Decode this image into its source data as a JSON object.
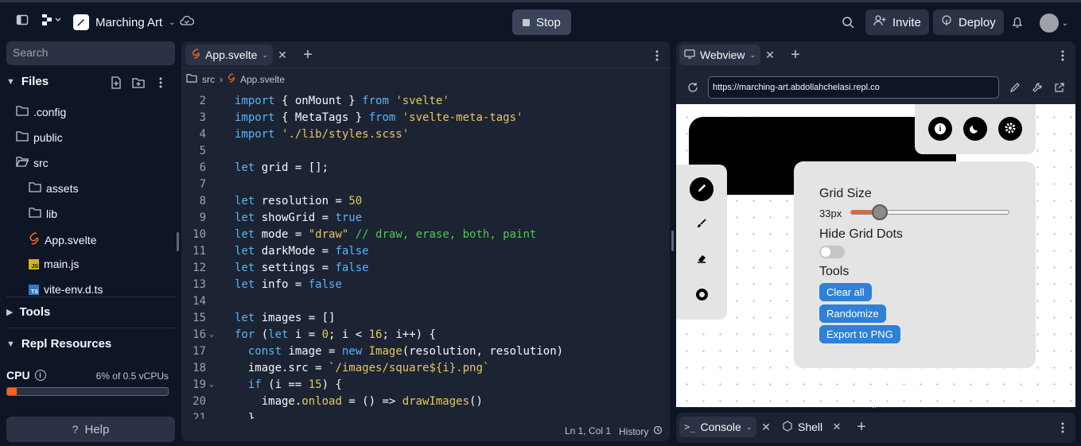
{
  "header": {
    "repl_name": "Marching Art",
    "stop_label": "Stop",
    "invite_label": "Invite",
    "deploy_label": "Deploy"
  },
  "sidebar": {
    "search_placeholder": "Search",
    "files_title": "Files",
    "items": [
      {
        "label": ".config",
        "icon": "folder-icon"
      },
      {
        "label": "public",
        "icon": "folder-icon"
      },
      {
        "label": "src",
        "icon": "folder-open-icon"
      },
      {
        "label": "assets",
        "icon": "folder-icon"
      },
      {
        "label": "lib",
        "icon": "folder-icon"
      },
      {
        "label": "App.svelte",
        "icon": "svelte-icon"
      },
      {
        "label": "main.js",
        "icon": "js-icon"
      },
      {
        "label": "vite-env.d.ts",
        "icon": "ts-icon"
      }
    ],
    "tools_title": "Tools",
    "resources_title": "Repl Resources",
    "cpu_label": "CPU",
    "cpu_value": "6% of 0.5 vCPUs",
    "cpu_fraction": 0.06,
    "help_label": "Help"
  },
  "editor": {
    "tab_label": "App.svelte",
    "breadcrumb_folder": "src",
    "breadcrumb_file": "App.svelte",
    "status_position": "Ln 1, Col 1",
    "history_label": "History",
    "line_numbers": [
      "2",
      "3",
      "4",
      "5",
      "6",
      "7",
      "8",
      "9",
      "10",
      "11",
      "12",
      "13",
      "14",
      "15",
      "16",
      "17",
      "18",
      "19",
      "20",
      "21"
    ]
  },
  "webview": {
    "tab_label": "Webview",
    "url": "https://marching-art.abdollahchelasi.repl.co",
    "grid_size_title": "Grid Size",
    "grid_size_value": "33px",
    "grid_size_fraction": 0.18,
    "hide_dots_title": "Hide Grid Dots",
    "tools_title": "Tools",
    "clear_label": "Clear all",
    "randomize_label": "Randomize",
    "export_label": "Export to PNG"
  },
  "console": {
    "console_label": "Console",
    "shell_label": "Shell"
  },
  "colors": {
    "accent_blue": "#2f80d6",
    "slider_orange": "#f26522",
    "bg": "#0e1525",
    "panel": "#1c2333"
  }
}
